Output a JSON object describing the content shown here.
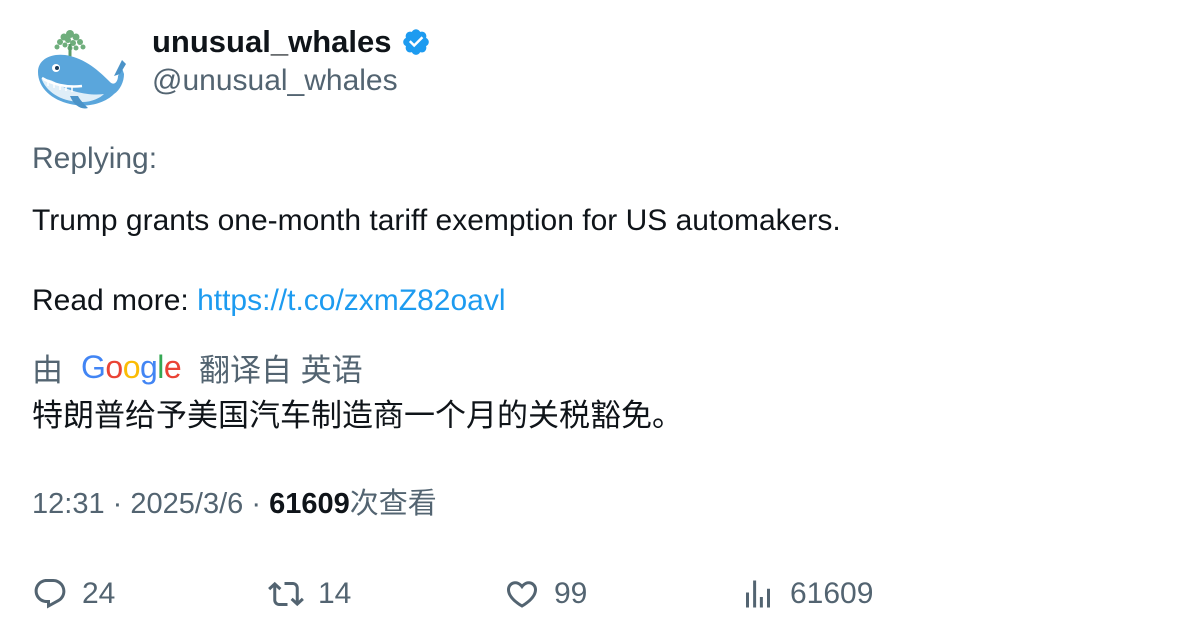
{
  "author": {
    "display_name": "unusual_whales",
    "handle": "@unusual_whales",
    "verified": true,
    "verified_color": "#1d9bf0"
  },
  "tweet": {
    "replying_label": "Replying:",
    "text": "Trump grants one-month tariff exemption for US automakers.",
    "read_more_prefix": "Read more: ",
    "link": "https://t.co/zxmZ82oavl"
  },
  "translation": {
    "by_label": "由",
    "provider": "Google",
    "translated_from": "翻译自 英语",
    "translated_text": "特朗普给予美国汽车制造商一个月的关税豁免。"
  },
  "meta": {
    "time": "12:31",
    "date": "2025/3/6",
    "separator": "·",
    "views_count": "61609",
    "views_label": "次查看"
  },
  "actions": {
    "replies": "24",
    "retweets": "14",
    "likes": "99",
    "views": "61609"
  },
  "colors": {
    "text_primary": "#0f1419",
    "text_secondary": "#536471",
    "link": "#1d9bf0"
  }
}
